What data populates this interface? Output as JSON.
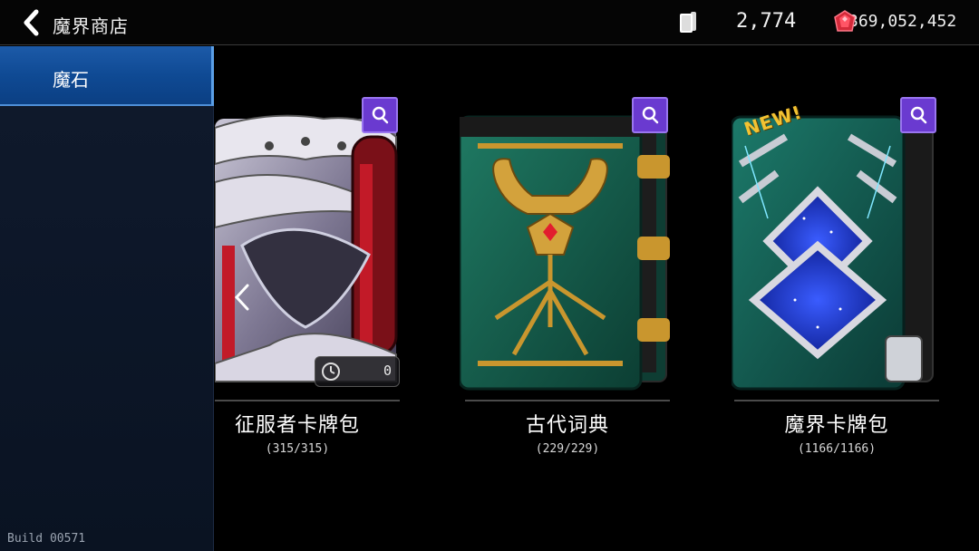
{
  "header": {
    "title": "魔界商店",
    "cards_count": "2,774",
    "gem_count": "369,052,452"
  },
  "sidebar": {
    "items": [
      {
        "label": "魔石"
      }
    ],
    "build": "Build 00571"
  },
  "packs": [
    {
      "name": "征服者卡牌包",
      "count": "(315/315)",
      "timer": "0"
    },
    {
      "name": "古代词典",
      "count": "(229/229)"
    },
    {
      "name": "魔界卡牌包",
      "count": "(1166/1166)",
      "badge": "NEW!"
    }
  ],
  "icons": {
    "back": "back-arrow-icon",
    "card": "card-icon",
    "gem": "red-gem-icon",
    "zoom": "magnifier-icon",
    "clock": "clock-icon",
    "scroll_left": "chevron-left-icon"
  },
  "colors": {
    "sidebar_active": "#0f4a94",
    "zoom_button": "#6a3ad0",
    "new_badge": "#f2c232"
  }
}
